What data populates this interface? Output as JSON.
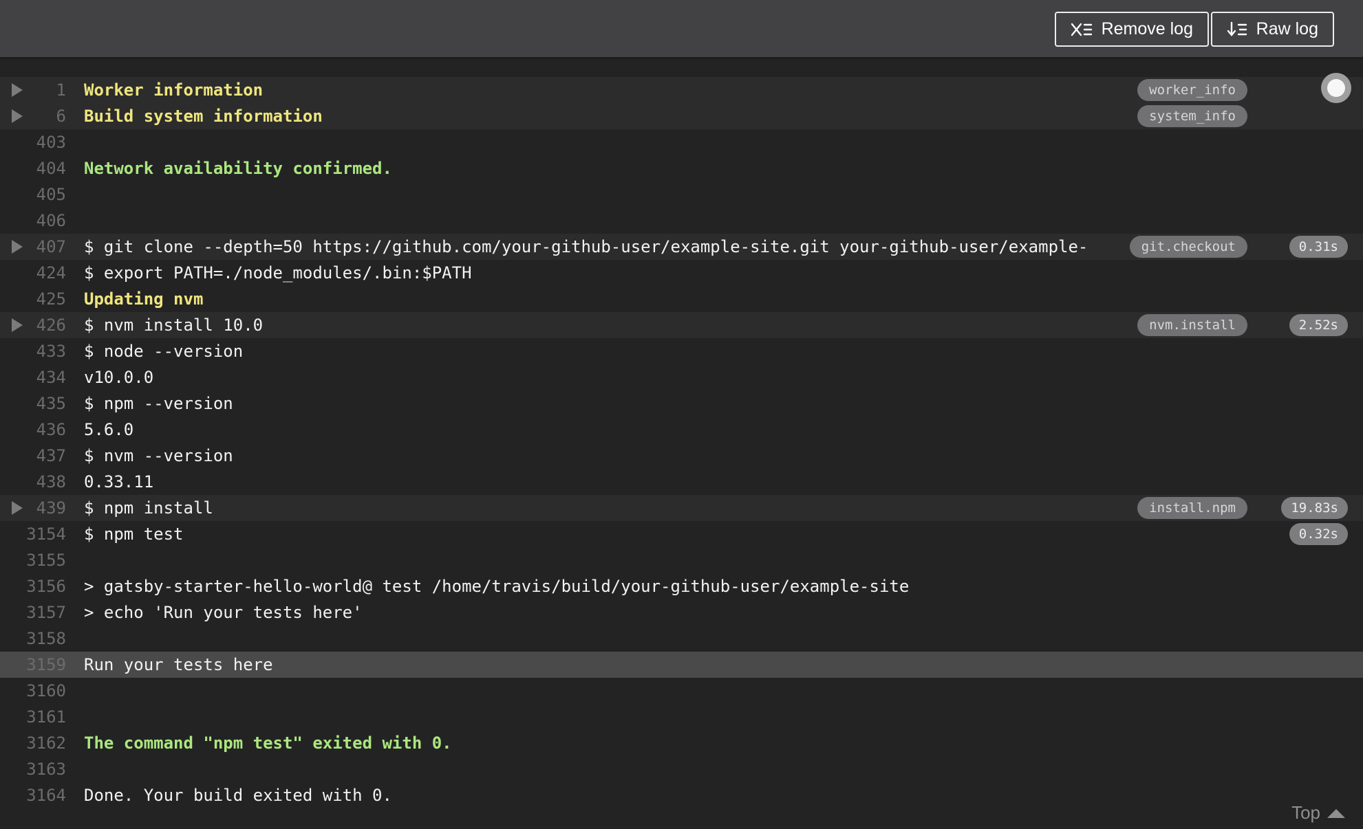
{
  "header": {
    "remove_log_label": "Remove log",
    "raw_log_label": "Raw log"
  },
  "footer": {
    "top_label": "Top"
  },
  "colors": {
    "header_bg": "#424244",
    "log_bg": "#232324",
    "fold_row_bg": "#2c2c2d",
    "selected_row_bg": "#4a4a4b",
    "line_number": "#6c6c6e",
    "log_text": "#f2f2f2",
    "fold_title_yellow": "#efe67d",
    "notice_green": "#ace77f",
    "badge_bg": "#717173",
    "time_badge_bg": "#7d7d7f"
  },
  "log": {
    "rows": [
      {
        "num": "1",
        "text": "Worker information",
        "style": "yellow",
        "fold": true,
        "fold_bg": true,
        "badge": "worker_info",
        "time": ""
      },
      {
        "num": "6",
        "text": "Build system information",
        "style": "yellow",
        "fold": true,
        "fold_bg": true,
        "badge": "system_info",
        "time": ""
      },
      {
        "num": "403",
        "text": "",
        "style": "plain",
        "fold": false,
        "fold_bg": false,
        "badge": "",
        "time": ""
      },
      {
        "num": "404",
        "text": "Network availability confirmed.",
        "style": "green",
        "fold": false,
        "fold_bg": false,
        "badge": "",
        "time": ""
      },
      {
        "num": "405",
        "text": "",
        "style": "plain",
        "fold": false,
        "fold_bg": false,
        "badge": "",
        "time": ""
      },
      {
        "num": "406",
        "text": "",
        "style": "plain",
        "fold": false,
        "fold_bg": false,
        "badge": "",
        "time": ""
      },
      {
        "num": "407",
        "text": "$ git clone --depth=50 https://github.com/your-github-user/example-site.git your-github-user/example-",
        "style": "plain",
        "fold": true,
        "fold_bg": true,
        "badge": "git.checkout",
        "time": "0.31s"
      },
      {
        "num": "424",
        "text": "$ export PATH=./node_modules/.bin:$PATH",
        "style": "plain",
        "fold": false,
        "fold_bg": false,
        "badge": "",
        "time": ""
      },
      {
        "num": "425",
        "text": "Updating nvm",
        "style": "yellow",
        "fold": false,
        "fold_bg": false,
        "badge": "",
        "time": ""
      },
      {
        "num": "426",
        "text": "$ nvm install 10.0",
        "style": "plain",
        "fold": true,
        "fold_bg": true,
        "badge": "nvm.install",
        "time": "2.52s"
      },
      {
        "num": "433",
        "text": "$ node --version",
        "style": "plain",
        "fold": false,
        "fold_bg": false,
        "badge": "",
        "time": ""
      },
      {
        "num": "434",
        "text": "v10.0.0",
        "style": "plain",
        "fold": false,
        "fold_bg": false,
        "badge": "",
        "time": ""
      },
      {
        "num": "435",
        "text": "$ npm --version",
        "style": "plain",
        "fold": false,
        "fold_bg": false,
        "badge": "",
        "time": ""
      },
      {
        "num": "436",
        "text": "5.6.0",
        "style": "plain",
        "fold": false,
        "fold_bg": false,
        "badge": "",
        "time": ""
      },
      {
        "num": "437",
        "text": "$ nvm --version",
        "style": "plain",
        "fold": false,
        "fold_bg": false,
        "badge": "",
        "time": ""
      },
      {
        "num": "438",
        "text": "0.33.11",
        "style": "plain",
        "fold": false,
        "fold_bg": false,
        "badge": "",
        "time": ""
      },
      {
        "num": "439",
        "text": "$ npm install",
        "style": "plain",
        "fold": true,
        "fold_bg": true,
        "badge": "install.npm",
        "time": "19.83s"
      },
      {
        "num": "3154",
        "text": "$ npm test",
        "style": "plain",
        "fold": false,
        "fold_bg": false,
        "badge": "",
        "time": "0.32s"
      },
      {
        "num": "3155",
        "text": "",
        "style": "plain",
        "fold": false,
        "fold_bg": false,
        "badge": "",
        "time": ""
      },
      {
        "num": "3156",
        "text": "> gatsby-starter-hello-world@ test /home/travis/build/your-github-user/example-site",
        "style": "plain",
        "fold": false,
        "fold_bg": false,
        "badge": "",
        "time": ""
      },
      {
        "num": "3157",
        "text": "> echo 'Run your tests here'",
        "style": "plain",
        "fold": false,
        "fold_bg": false,
        "badge": "",
        "time": ""
      },
      {
        "num": "3158",
        "text": "",
        "style": "plain",
        "fold": false,
        "fold_bg": false,
        "badge": "",
        "time": ""
      },
      {
        "num": "3159",
        "text": "Run your tests here",
        "style": "plain",
        "fold": false,
        "fold_bg": false,
        "selected": true,
        "badge": "",
        "time": ""
      },
      {
        "num": "3160",
        "text": "",
        "style": "plain",
        "fold": false,
        "fold_bg": false,
        "badge": "",
        "time": ""
      },
      {
        "num": "3161",
        "text": "",
        "style": "plain",
        "fold": false,
        "fold_bg": false,
        "badge": "",
        "time": ""
      },
      {
        "num": "3162",
        "text": "The command \"npm test\" exited with 0.",
        "style": "green",
        "fold": false,
        "fold_bg": false,
        "badge": "",
        "time": ""
      },
      {
        "num": "3163",
        "text": "",
        "style": "plain",
        "fold": false,
        "fold_bg": false,
        "badge": "",
        "time": ""
      },
      {
        "num": "3164",
        "text": "Done. Your build exited with 0.",
        "style": "plain",
        "fold": false,
        "fold_bg": false,
        "badge": "",
        "time": ""
      }
    ]
  }
}
